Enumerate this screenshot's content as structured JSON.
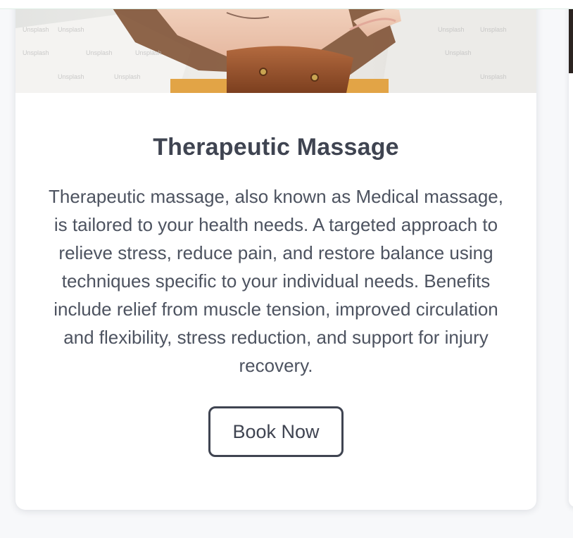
{
  "service_card": {
    "title": "Therapeutic Massage",
    "description": "Therapeutic massage, also known as Medical massage, is tailored to your health needs. A targeted approach to relieve stress, reduce pain, and restore balance using techniques specific to your individual needs. Benefits include relief from muscle tension, improved circulation and flexibility, stress reduction, and support for injury recovery.",
    "button_label": "Book Now",
    "image_icon": "massage-photo",
    "image_watermark": "Unsplash"
  },
  "colors": {
    "page_background": "#f7f8fa",
    "card_background": "#ffffff",
    "title_text": "#3f4451",
    "body_text": "#4d5360",
    "button_border": "#3f4451"
  }
}
